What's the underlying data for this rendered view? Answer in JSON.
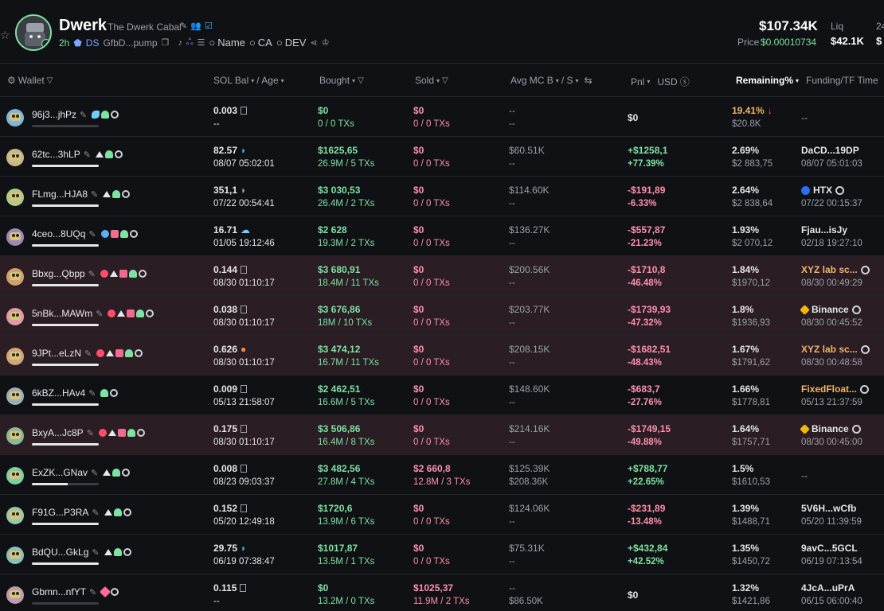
{
  "token": {
    "name": "Dwerk",
    "full_name": "The Dwerk Cabal",
    "age": "2h",
    "ds": "DS",
    "address": "GfbD...pump",
    "links": {
      "name": "Name",
      "ca": "CA",
      "dev": "DEV"
    },
    "market_cap": "$107.34K",
    "price_label": "Price",
    "price": "$0.00010734",
    "liq_label": "Liq",
    "liq": "$42.1K",
    "cut_label": "24",
    "cut_value": "$"
  },
  "columns": {
    "wallet": "Wallet",
    "sol_bal": "SOL Bal",
    "age": "/ Age",
    "bought": "Bought",
    "sold": "Sold",
    "avg": "Avg MC B",
    "avg_s": "/ S",
    "pnl": "Pnl",
    "usd": "USD",
    "remaining": "Remaining%",
    "funding": "Funding/TF Time"
  },
  "rows": [
    {
      "addr": "96j3...jhPz",
      "tags": [
        "fish",
        "user",
        "ring"
      ],
      "bar": 0,
      "sol": "0.003",
      "sol_icon": "box",
      "age": "--",
      "bought": "$0",
      "bought_tx": "0 / 0 TXs",
      "sold": "$0",
      "sold_tx": "0 / 0 TXs",
      "avg_b": "--",
      "avg_s": "--",
      "pnl": "$0",
      "pnl_pct": "",
      "rem": "19.41%",
      "rem_usd": "$20.8K",
      "fund": "--",
      "fund_time": "",
      "hl": false,
      "pnl_type": "neu",
      "rem_warn": true,
      "fund_icon": "",
      "fund_gold": false
    },
    {
      "addr": "62tc...3hLP",
      "tags": [
        "tri",
        "user",
        "ring"
      ],
      "bar": 1.0,
      "sol": "82.57",
      "sol_icon": "dolph",
      "age": "08/07 05:02:01",
      "bought": "$1625,65",
      "bought_tx": "26.9M / 5 TXs",
      "sold": "$0",
      "sold_tx": "0 / 0 TXs",
      "avg_b": "$60.51K",
      "avg_s": "--",
      "pnl": "+$1258,1",
      "pnl_pct": "+77.39%",
      "rem": "2.69%",
      "rem_usd": "$2 883,75",
      "fund": "DaCD...19DP",
      "fund_time": "08/07 05:01:03",
      "hl": false,
      "pnl_type": "pos",
      "rem_warn": false,
      "fund_icon": "",
      "fund_gold": false
    },
    {
      "addr": "FLmg...HJA8",
      "tags": [
        "tri",
        "user",
        "ring"
      ],
      "bar": 1.0,
      "sol": "351,1",
      "sol_icon": "gray",
      "age": "07/22 00:54:41",
      "bought": "$3 030,53",
      "bought_tx": "26.4M / 2 TXs",
      "sold": "$0",
      "sold_tx": "0 / 0 TXs",
      "avg_b": "$114.60K",
      "avg_s": "--",
      "pnl": "-$191,89",
      "pnl_pct": "-6.33%",
      "rem": "2.64%",
      "rem_usd": "$2 838,64",
      "fund": "HTX",
      "fund_time": "07/22 00:15:37",
      "hl": false,
      "pnl_type": "neg",
      "rem_warn": false,
      "fund_icon": "htx",
      "fund_gold": false
    },
    {
      "addr": "4ceo...8UQq",
      "tags": [
        "blue",
        "stack",
        "user",
        "ring"
      ],
      "bar": 1.0,
      "sol": "16.71",
      "sol_icon": "cloud",
      "age": "01/05 19:12:46",
      "bought": "$2 628",
      "bought_tx": "19.3M / 2 TXs",
      "sold": "$0",
      "sold_tx": "0 / 0 TXs",
      "avg_b": "$136.27K",
      "avg_s": "--",
      "pnl": "-$557,87",
      "pnl_pct": "-21.23%",
      "rem": "1.93%",
      "rem_usd": "$2 070,12",
      "fund": "Fjau...isJy",
      "fund_time": "02/18 19:27:10",
      "hl": false,
      "pnl_type": "neg",
      "rem_warn": false,
      "fund_icon": "",
      "fund_gold": false
    },
    {
      "addr": "Bbxg...Qbpp",
      "tags": [
        "alert",
        "tri",
        "stack",
        "user",
        "ring"
      ],
      "bar": 1.0,
      "sol": "0.144",
      "sol_icon": "box",
      "age": "08/30 01:10:17",
      "bought": "$3 680,91",
      "bought_tx": "18.4M / 11 TXs",
      "sold": "$0",
      "sold_tx": "0 / 0 TXs",
      "avg_b": "$200.56K",
      "avg_s": "--",
      "pnl": "-$1710,8",
      "pnl_pct": "-46.48%",
      "rem": "1.84%",
      "rem_usd": "$1970,12",
      "fund": "XYZ lab sc...",
      "fund_time": "08/30 00:49:29",
      "hl": true,
      "pnl_type": "neg",
      "rem_warn": false,
      "fund_icon": "ring",
      "fund_gold": true
    },
    {
      "addr": "5nBk...MAWm",
      "tags": [
        "alert",
        "tri",
        "stack",
        "user",
        "ring"
      ],
      "bar": 1.0,
      "sol": "0.038",
      "sol_icon": "box",
      "age": "08/30 01:10:17",
      "bought": "$3 676,86",
      "bought_tx": "18M / 10 TXs",
      "sold": "$0",
      "sold_tx": "0 / 0 TXs",
      "avg_b": "$203.77K",
      "avg_s": "--",
      "pnl": "-$1739,93",
      "pnl_pct": "-47.32%",
      "rem": "1.8%",
      "rem_usd": "$1936,93",
      "fund": "Binance",
      "fund_time": "08/30 00:45:52",
      "hl": true,
      "pnl_type": "neg",
      "rem_warn": false,
      "fund_icon": "bin",
      "fund_gold": false
    },
    {
      "addr": "9JPt...eLzN",
      "tags": [
        "alert",
        "tri",
        "stack",
        "user",
        "ring"
      ],
      "bar": 1.0,
      "sol": "0.626",
      "sol_icon": "orange",
      "age": "08/30 01:10:17",
      "bought": "$3 474,12",
      "bought_tx": "16.7M / 11 TXs",
      "sold": "$0",
      "sold_tx": "0 / 0 TXs",
      "avg_b": "$208.15K",
      "avg_s": "--",
      "pnl": "-$1682,51",
      "pnl_pct": "-48.43%",
      "rem": "1.67%",
      "rem_usd": "$1791,62",
      "fund": "XYZ lab sc...",
      "fund_time": "08/30 00:48:58",
      "hl": true,
      "pnl_type": "neg",
      "rem_warn": false,
      "fund_icon": "ring",
      "fund_gold": true
    },
    {
      "addr": "6kBZ...HAv4",
      "tags": [
        "user",
        "ring"
      ],
      "bar": 1.0,
      "sol": "0.009",
      "sol_icon": "box",
      "age": "05/13 21:58:07",
      "bought": "$2 462,51",
      "bought_tx": "16.6M / 5 TXs",
      "sold": "$0",
      "sold_tx": "0 / 0 TXs",
      "avg_b": "$148.60K",
      "avg_s": "--",
      "pnl": "-$683,7",
      "pnl_pct": "-27.76%",
      "rem": "1.66%",
      "rem_usd": "$1778,81",
      "fund": "FixedFloat...",
      "fund_time": "05/13 21:37:59",
      "hl": false,
      "pnl_type": "neg",
      "rem_warn": false,
      "fund_icon": "ring",
      "fund_gold": true
    },
    {
      "addr": "BxyA...Jc8P",
      "tags": [
        "alert",
        "tri",
        "stack",
        "user",
        "ring"
      ],
      "bar": 1.0,
      "sol": "0.175",
      "sol_icon": "box",
      "age": "08/30 01:10:17",
      "bought": "$3 506,86",
      "bought_tx": "16.4M / 8 TXs",
      "sold": "$0",
      "sold_tx": "0 / 0 TXs",
      "avg_b": "$214.16K",
      "avg_s": "--",
      "pnl": "-$1749,15",
      "pnl_pct": "-49.88%",
      "rem": "1.64%",
      "rem_usd": "$1757,71",
      "fund": "Binance",
      "fund_time": "08/30 00:45:00",
      "hl": true,
      "pnl_type": "neg",
      "rem_warn": false,
      "fund_icon": "bin",
      "fund_gold": false
    },
    {
      "addr": "ExZK...GNav",
      "tags": [
        "tri",
        "user",
        "ring"
      ],
      "bar": 0.53,
      "sol": "0.008",
      "sol_icon": "box",
      "age": "08/23 09:03:37",
      "bought": "$3 482,56",
      "bought_tx": "27.8M / 4 TXs",
      "sold": "$2 660,8",
      "sold_tx": "12.8M / 3 TXs",
      "avg_b": "$125.39K",
      "avg_s": "$208.36K",
      "pnl": "+$788,77",
      "pnl_pct": "+22.65%",
      "rem": "1.5%",
      "rem_usd": "$1610,53",
      "fund": "--",
      "fund_time": "",
      "hl": false,
      "pnl_type": "pos",
      "rem_warn": false,
      "fund_icon": "",
      "fund_gold": false
    },
    {
      "addr": "F91G...P3RA",
      "tags": [
        "tri",
        "user",
        "ring"
      ],
      "bar": 1.0,
      "sol": "0.152",
      "sol_icon": "box",
      "age": "05/20 12:49:18",
      "bought": "$1720,6",
      "bought_tx": "13.9M / 6 TXs",
      "sold": "$0",
      "sold_tx": "0 / 0 TXs",
      "avg_b": "$124.06K",
      "avg_s": "--",
      "pnl": "-$231,89",
      "pnl_pct": "-13.48%",
      "rem": "1.39%",
      "rem_usd": "$1488,71",
      "fund": "5V6H...wCfb",
      "fund_time": "05/20 11:39:59",
      "hl": false,
      "pnl_type": "neg",
      "rem_warn": false,
      "fund_icon": "",
      "fund_gold": false
    },
    {
      "addr": "BdQU...GkLg",
      "tags": [
        "tri",
        "user",
        "ring"
      ],
      "bar": 1.0,
      "sol": "29.75",
      "sol_icon": "dolph",
      "age": "06/19 07:38:47",
      "bought": "$1017,87",
      "bought_tx": "13.5M / 1 TXs",
      "sold": "$0",
      "sold_tx": "0 / 0 TXs",
      "avg_b": "$75.31K",
      "avg_s": "--",
      "pnl": "+$432,84",
      "pnl_pct": "+42.52%",
      "rem": "1.35%",
      "rem_usd": "$1450,72",
      "fund": "9avC...5GCL",
      "fund_time": "06/19 07:13:54",
      "hl": false,
      "pnl_type": "pos",
      "rem_warn": false,
      "fund_icon": "",
      "fund_gold": false
    },
    {
      "addr": "Gbmn...nfYT",
      "tags": [
        "pink",
        "ring"
      ],
      "bar": 0,
      "sol": "0.115",
      "sol_icon": "box",
      "age": "--",
      "bought": "$0",
      "bought_tx": "13.2M / 0 TXs",
      "sold": "$1025,37",
      "sold_tx": "11.9M / 2 TXs",
      "avg_b": "--",
      "avg_s": "$86.50K",
      "pnl": "$0",
      "pnl_pct": "",
      "rem": "1.32%",
      "rem_usd": "$1421,86",
      "fund": "4JcA...uPrA",
      "fund_time": "06/15 06:00:40",
      "hl": false,
      "pnl_type": "neu",
      "rem_warn": false,
      "fund_icon": "",
      "fund_gold": false
    }
  ]
}
